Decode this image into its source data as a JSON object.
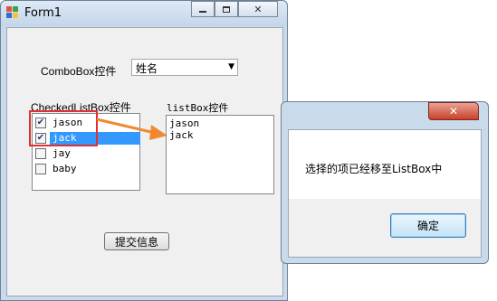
{
  "form1": {
    "title": "Form1",
    "combo_label": "ComboBox控件",
    "combo_value": "姓名",
    "checkedlist_label": "CheckedListBox控件",
    "checkedlist_items": [
      {
        "label": "jason",
        "checked": true,
        "selected": false
      },
      {
        "label": "jack",
        "checked": true,
        "selected": true
      },
      {
        "label": "jay",
        "checked": false,
        "selected": false
      },
      {
        "label": "baby",
        "checked": false,
        "selected": false
      }
    ],
    "listbox_label": "listBox控件",
    "listbox_items": [
      "jason",
      "jack"
    ],
    "submit_label": "提交信息"
  },
  "dialog": {
    "message": "选择的项已经移至ListBox中",
    "ok_label": "确定",
    "close_glyph": "✕"
  },
  "colors": {
    "highlight_box": "#e03030",
    "arrow": "#f08a30",
    "selection": "#3399ff"
  }
}
